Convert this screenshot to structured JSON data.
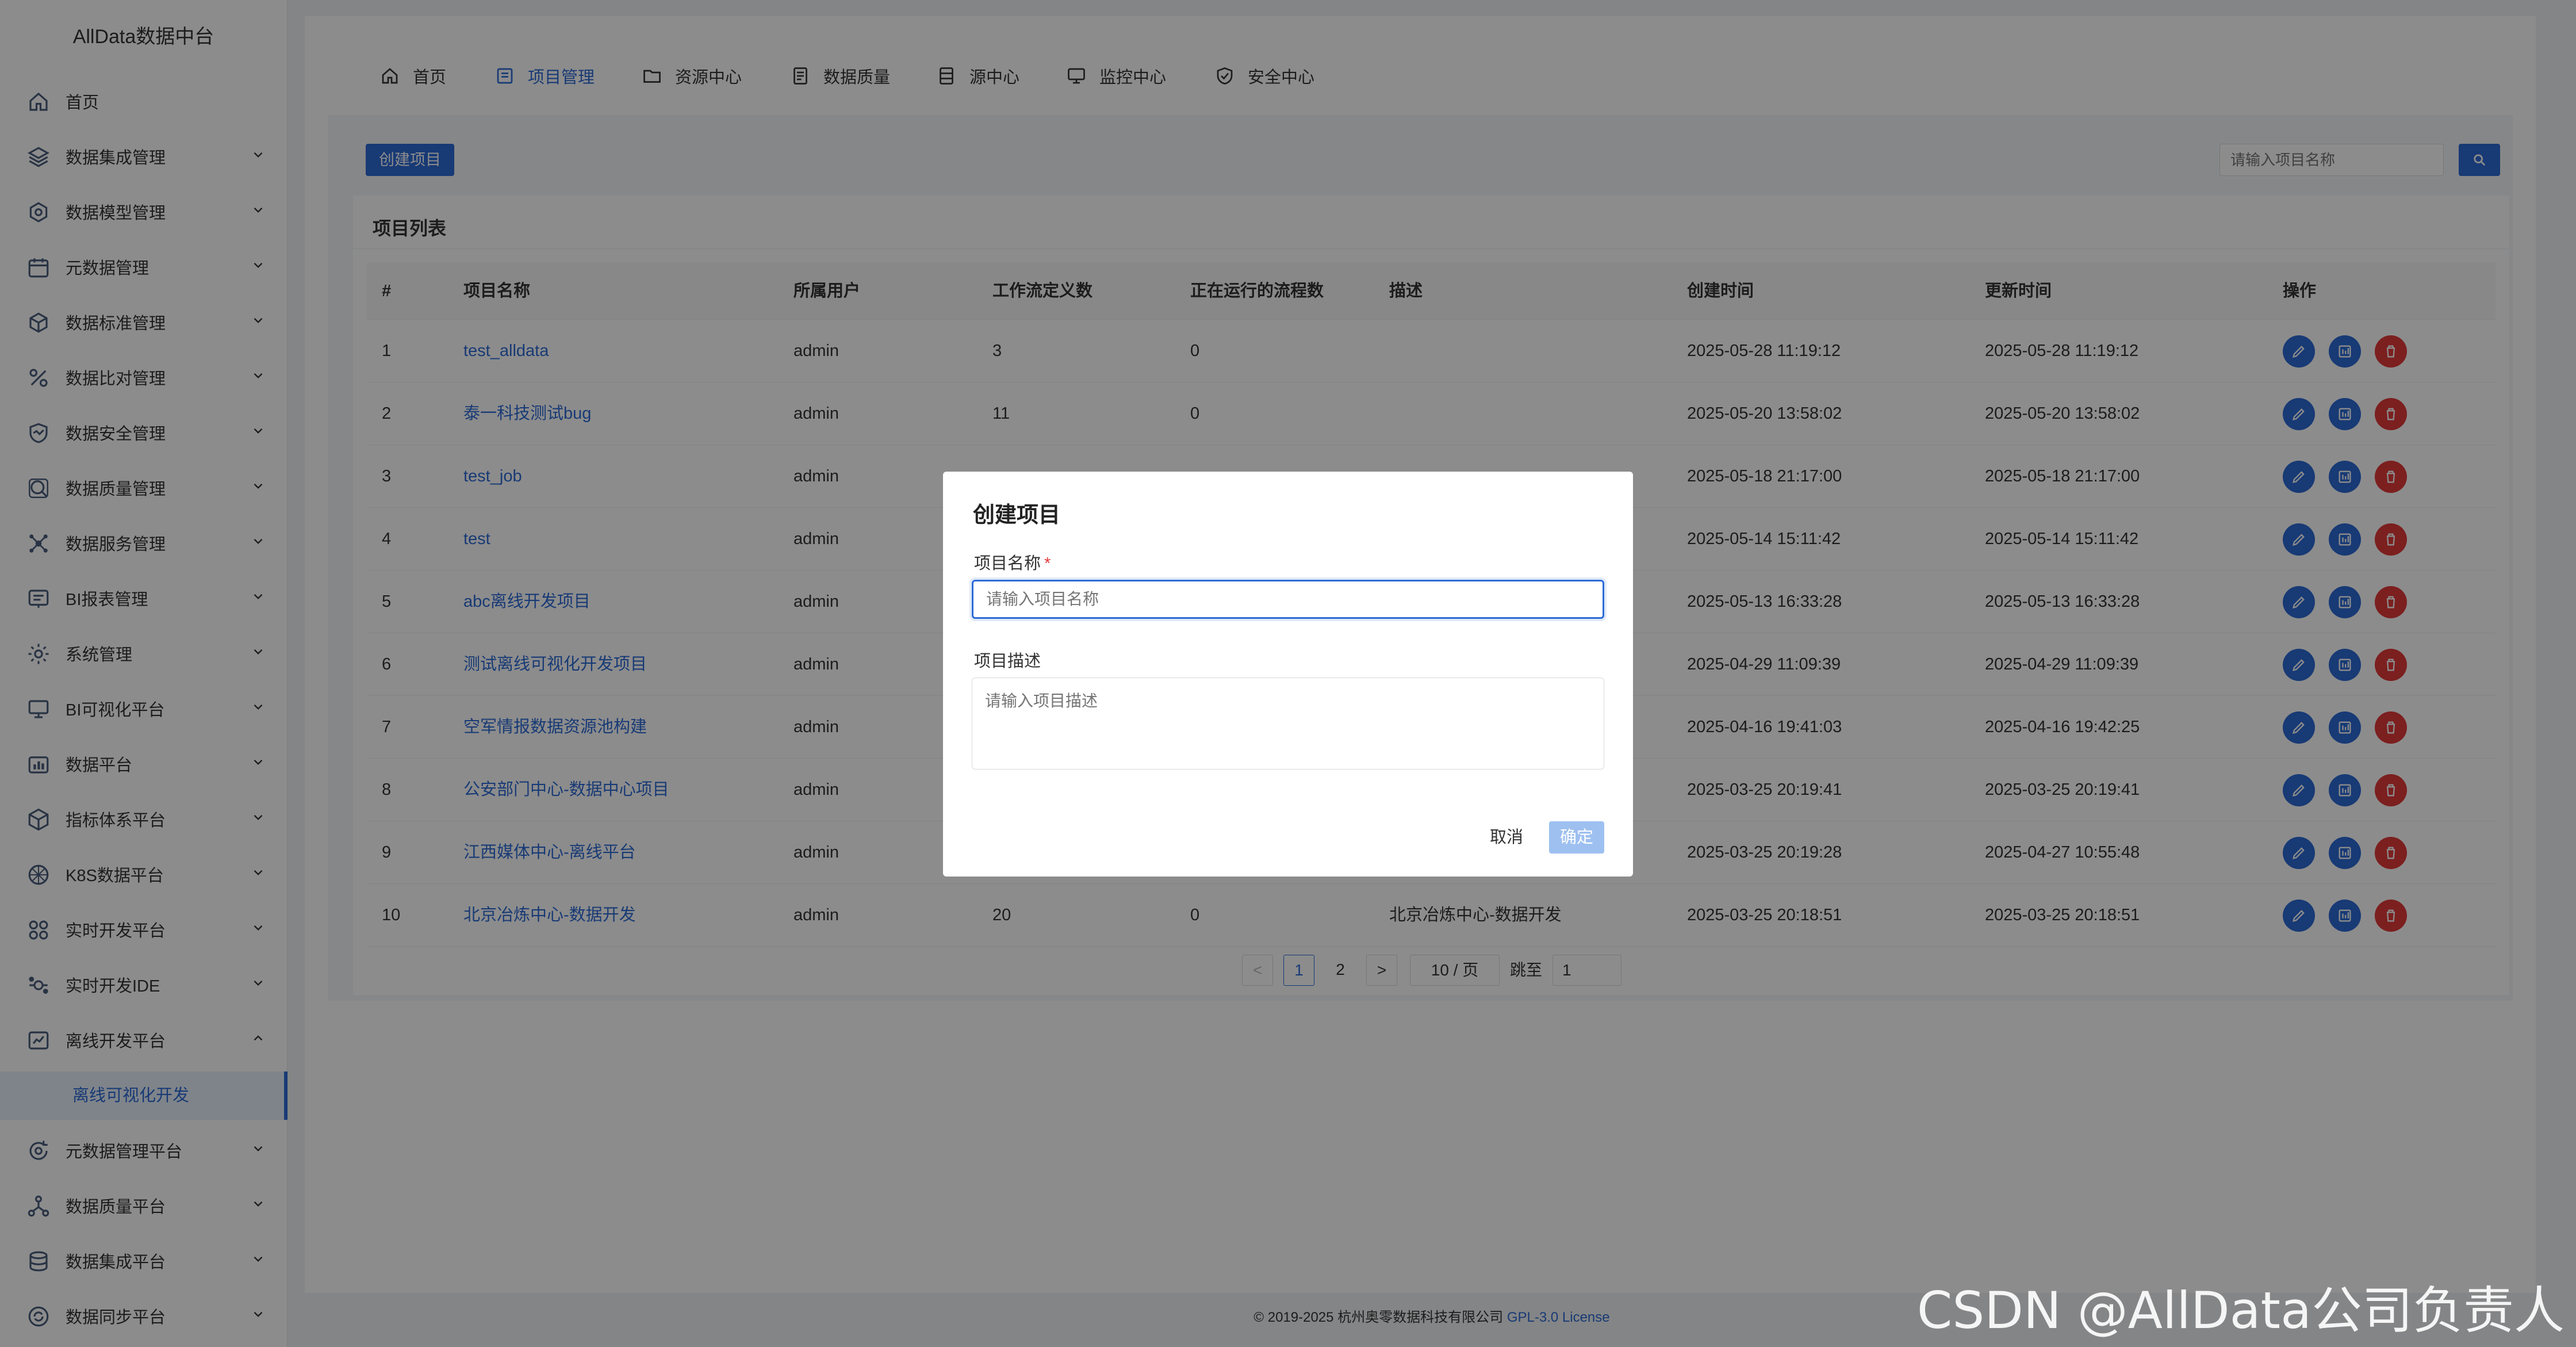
{
  "app": {
    "title": "AllData数据中台"
  },
  "sidebar": {
    "items": [
      {
        "label": "首页",
        "icon": "home-icon",
        "chevron": ""
      },
      {
        "label": "数据集成管理",
        "icon": "layers-icon",
        "chevron": "down"
      },
      {
        "label": "数据模型管理",
        "icon": "model-icon",
        "chevron": "down"
      },
      {
        "label": "元数据管理",
        "icon": "calendar-icon",
        "chevron": "down"
      },
      {
        "label": "数据标准管理",
        "icon": "cube-icon",
        "chevron": "down"
      },
      {
        "label": "数据比对管理",
        "icon": "percent-icon",
        "chevron": "down"
      },
      {
        "label": "数据安全管理",
        "icon": "shield-icon",
        "chevron": "down"
      },
      {
        "label": "数据质量管理",
        "icon": "search-icon",
        "chevron": "down"
      },
      {
        "label": "数据服务管理",
        "icon": "service-icon",
        "chevron": "down"
      },
      {
        "label": "BI报表管理",
        "icon": "report-icon",
        "chevron": "down"
      },
      {
        "label": "系统管理",
        "icon": "settings-icon",
        "chevron": "down"
      },
      {
        "label": "BI可视化平台",
        "icon": "monitor-icon",
        "chevron": "down"
      },
      {
        "label": "数据平台",
        "icon": "chart-icon",
        "chevron": "down"
      },
      {
        "label": "指标体系平台",
        "icon": "box-icon",
        "chevron": "down"
      },
      {
        "label": "K8S数据平台",
        "icon": "k8s-icon",
        "chevron": "down"
      },
      {
        "label": "实时开发平台",
        "icon": "grid-icon",
        "chevron": "down"
      },
      {
        "label": "实时开发IDE",
        "icon": "ide-icon",
        "chevron": "down"
      },
      {
        "label": "离线开发平台",
        "icon": "offline-icon",
        "chevron": "up"
      },
      {
        "label": "元数据管理平台",
        "icon": "refresh-icon",
        "chevron": "down"
      },
      {
        "label": "数据质量平台",
        "icon": "network-icon",
        "chevron": "down"
      },
      {
        "label": "数据集成平台",
        "icon": "database-icon",
        "chevron": "down"
      },
      {
        "label": "数据同步平台",
        "icon": "sync-icon",
        "chevron": "down"
      }
    ],
    "sub_item": {
      "label": "离线可视化开发"
    }
  },
  "topnav": {
    "items": [
      {
        "label": "首页",
        "icon": "home-icon",
        "active": false
      },
      {
        "label": "项目管理",
        "icon": "project-icon",
        "active": true
      },
      {
        "label": "资源中心",
        "icon": "folder-icon",
        "active": false
      },
      {
        "label": "数据质量",
        "icon": "document-icon",
        "active": false
      },
      {
        "label": "源中心",
        "icon": "server-icon",
        "active": false
      },
      {
        "label": "监控中心",
        "icon": "monitor-icon",
        "active": false
      },
      {
        "label": "安全中心",
        "icon": "shield-check-icon",
        "active": false
      }
    ]
  },
  "toolbar": {
    "create_label": "创建项目",
    "search_placeholder": "请输入项目名称"
  },
  "list": {
    "title": "项目列表",
    "columns": [
      "#",
      "项目名称",
      "所属用户",
      "工作流定义数",
      "正在运行的流程数",
      "描述",
      "创建时间",
      "更新时间",
      "操作"
    ],
    "rows": [
      {
        "no": "1",
        "name": "test_alldata",
        "user": "admin",
        "workflows": "3",
        "running": "0",
        "desc": "",
        "created": "2025-05-28 11:19:12",
        "updated": "2025-05-28 11:19:12"
      },
      {
        "no": "2",
        "name": "泰一科技测试bug",
        "user": "admin",
        "workflows": "11",
        "running": "0",
        "desc": "",
        "created": "2025-05-20 13:58:02",
        "updated": "2025-05-20 13:58:02"
      },
      {
        "no": "3",
        "name": "test_job",
        "user": "admin",
        "workflows": "",
        "running": "",
        "desc": "",
        "created": "2025-05-18 21:17:00",
        "updated": "2025-05-18 21:17:00"
      },
      {
        "no": "4",
        "name": "test",
        "user": "admin",
        "workflows": "",
        "running": "",
        "desc": "",
        "created": "2025-05-14 15:11:42",
        "updated": "2025-05-14 15:11:42"
      },
      {
        "no": "5",
        "name": "abc离线开发项目",
        "user": "admin",
        "workflows": "",
        "running": "",
        "desc": "",
        "created": "2025-05-13 16:33:28",
        "updated": "2025-05-13 16:33:28"
      },
      {
        "no": "6",
        "name": "测试离线可视化开发项目",
        "user": "admin",
        "workflows": "",
        "running": "",
        "desc": "",
        "created": "2025-04-29 11:09:39",
        "updated": "2025-04-29 11:09:39"
      },
      {
        "no": "7",
        "name": "空军情报数据资源池构建",
        "user": "admin",
        "workflows": "",
        "running": "",
        "desc": "",
        "created": "2025-04-16 19:41:03",
        "updated": "2025-04-16 19:42:25"
      },
      {
        "no": "8",
        "name": "公安部门中心-数据中心项目",
        "user": "admin",
        "workflows": "",
        "running": "",
        "desc": "",
        "created": "2025-03-25 20:19:41",
        "updated": "2025-03-25 20:19:41"
      },
      {
        "no": "9",
        "name": "江西媒体中心-离线平台",
        "user": "admin",
        "workflows": "",
        "running": "",
        "desc": "",
        "created": "2025-03-25 20:19:28",
        "updated": "2025-04-27 10:55:48"
      },
      {
        "no": "10",
        "name": "北京冶炼中心-数据开发",
        "user": "admin",
        "workflows": "20",
        "running": "0",
        "desc": "北京冶炼中心-数据开发",
        "created": "2025-03-25 20:18:51",
        "updated": "2025-03-25 20:18:51"
      }
    ]
  },
  "pagination": {
    "prev": "<",
    "pages": [
      "1",
      "2"
    ],
    "current": "1",
    "next": ">",
    "page_size": "10 / 页",
    "jump_label": "跳至",
    "jump_value": "1"
  },
  "footer": {
    "copyright": "© 2019-2025 杭州奥零数据科技有限公司 ",
    "license": "GPL-3.0 License"
  },
  "watermark": "CSDN @AllData公司负责人",
  "modal": {
    "title": "创建项目",
    "name_label": "项目名称",
    "required_mark": "*",
    "name_placeholder": "请输入项目名称",
    "desc_label": "项目描述",
    "desc_placeholder": "请输入项目描述",
    "cancel_label": "取消",
    "ok_label": "确定"
  },
  "colors": {
    "primary": "#2d6bd6",
    "danger": "#e23a3a",
    "overlay": "rgba(0,0,0,0.45)"
  }
}
